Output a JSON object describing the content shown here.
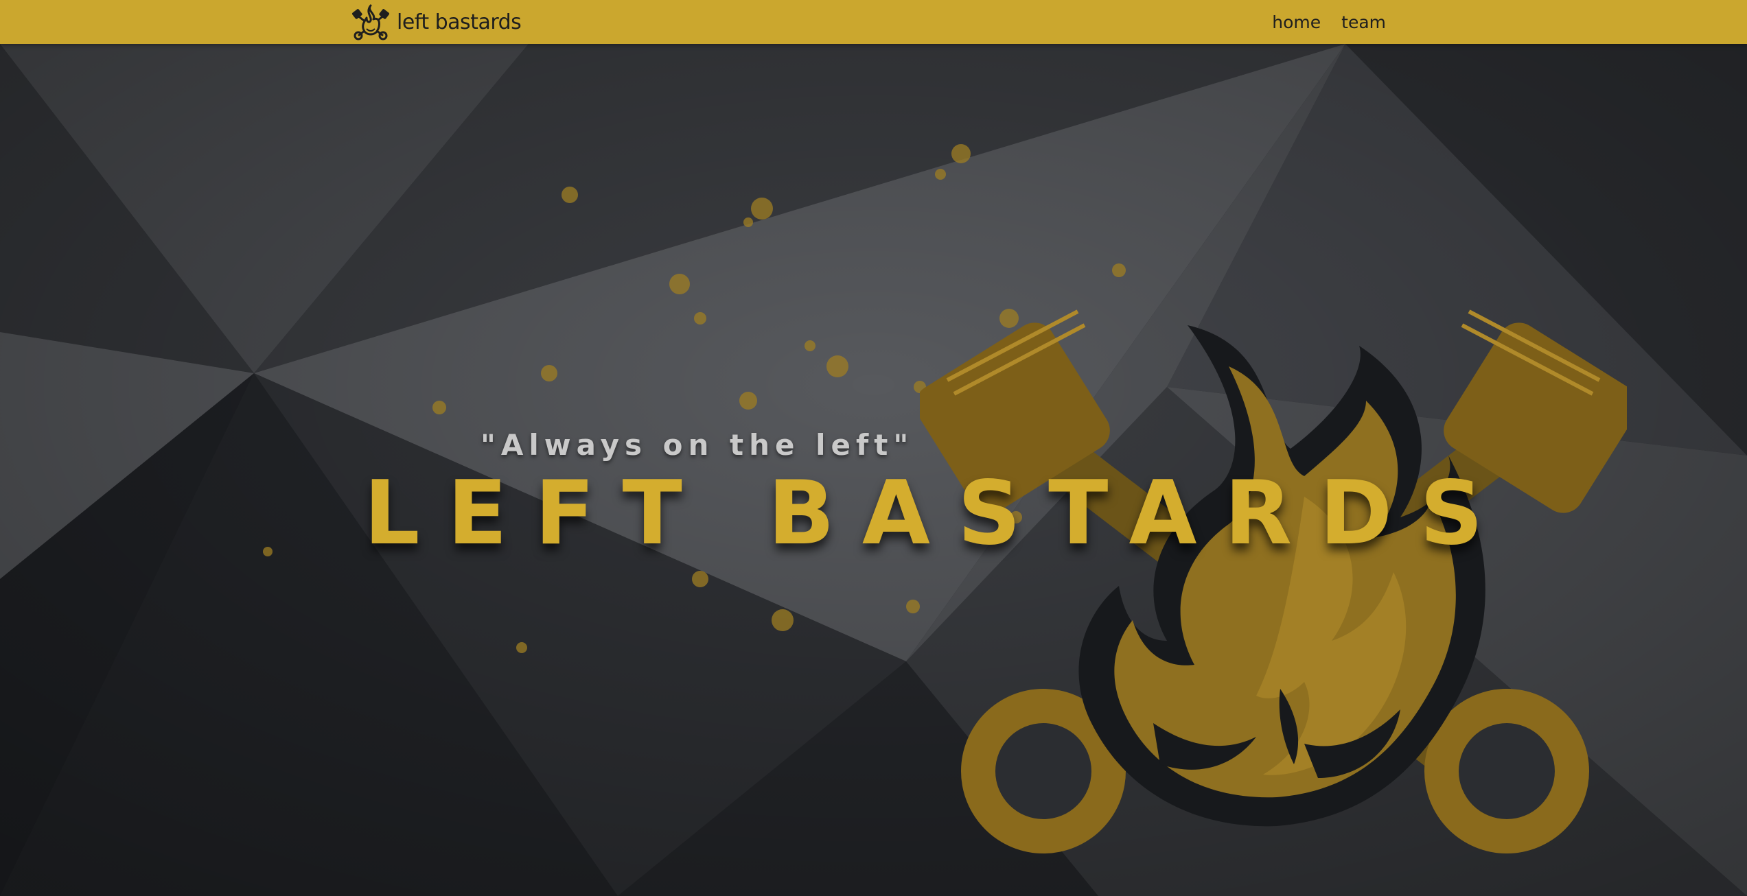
{
  "colors": {
    "navbar_bg": "#cba72e",
    "title_gold": "#d4ad2e",
    "tagline_grey": "#c9c9c9",
    "background_dark": "#2a2c30"
  },
  "header": {
    "brand_icon": "flame-pistons-logo-icon",
    "brand_text": "left bastards",
    "nav": [
      {
        "label": "home"
      },
      {
        "label": "team"
      }
    ]
  },
  "hero": {
    "tagline": "\"Always on the left\"",
    "title": "LEFT BASTARDS",
    "emblem_icon": "flame-crossed-pistons-emblem-icon"
  }
}
